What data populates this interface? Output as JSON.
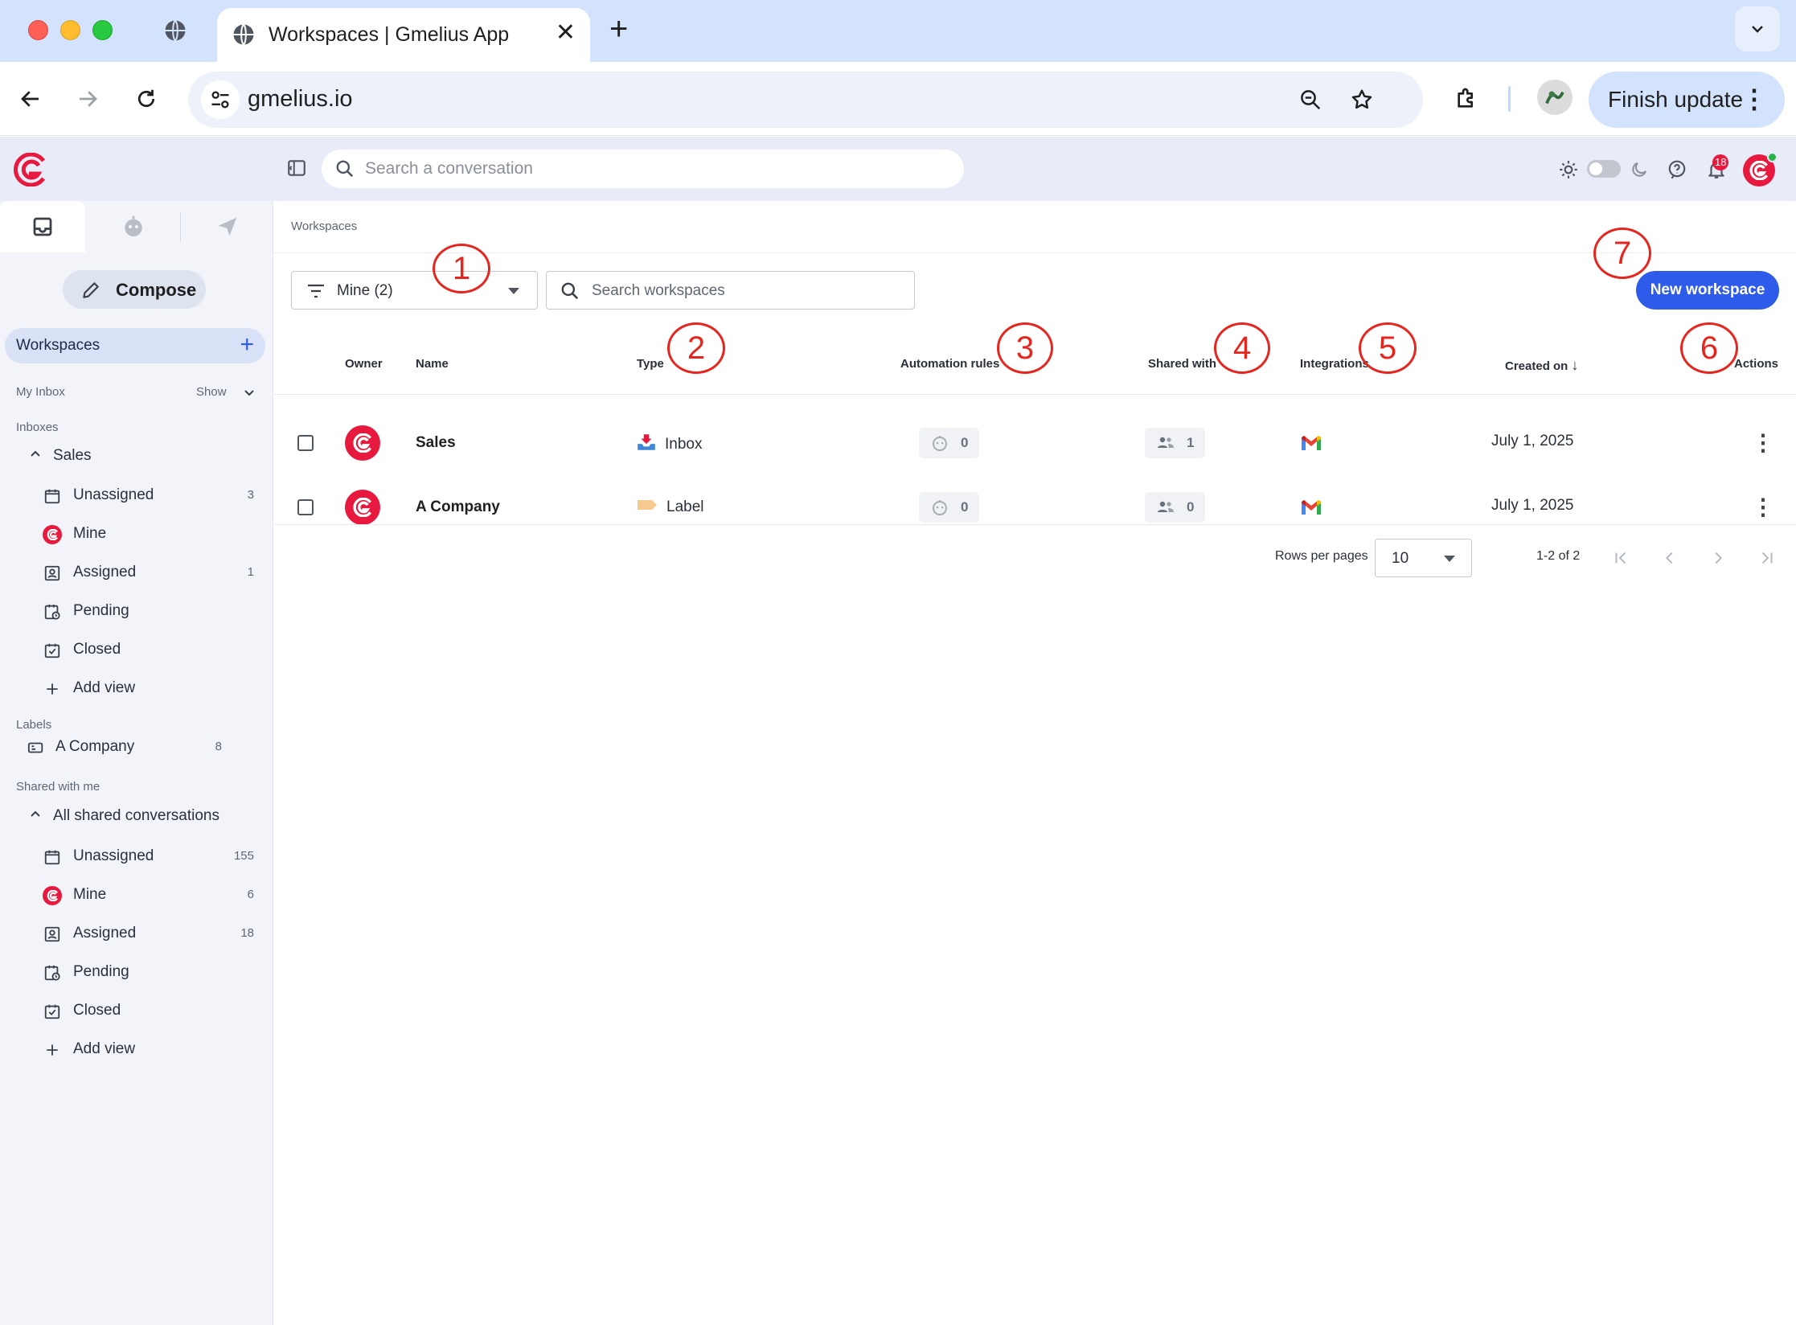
{
  "browser": {
    "tab_title": "Workspaces | Gmelius App",
    "tab_close": "✕",
    "new_tab": "+",
    "url": "gmelius.io",
    "finish_update": "Finish update",
    "menu_dots": "⋮"
  },
  "header": {
    "search_placeholder": "Search a conversation",
    "notification_count": "18"
  },
  "sidebar": {
    "compose_label": "Compose",
    "workspaces_label": "Workspaces",
    "workspaces_add": "+",
    "my_inbox_label": "My Inbox",
    "show_label": "Show",
    "inboxes_label": "Inboxes",
    "sales_group": "Sales",
    "sales_items": [
      {
        "label": "Unassigned",
        "count": "3",
        "icon": "calendar-icon"
      },
      {
        "label": "Mine",
        "count": "",
        "icon": "gmelius-logo-icon"
      },
      {
        "label": "Assigned",
        "count": "1",
        "icon": "assigned-icon"
      },
      {
        "label": "Pending",
        "count": "",
        "icon": "pending-icon"
      },
      {
        "label": "Closed",
        "count": "",
        "icon": "closed-icon"
      },
      {
        "label": "Add view",
        "count": "",
        "icon": "plus-icon"
      }
    ],
    "labels_label": "Labels",
    "label_items": [
      {
        "label": "A Company",
        "count": "8",
        "icon": "label-icon"
      }
    ],
    "shared_label": "Shared with me",
    "shared_group": "All shared conversations",
    "shared_items": [
      {
        "label": "Unassigned",
        "count": "155",
        "icon": "calendar-icon"
      },
      {
        "label": "Mine",
        "count": "6",
        "icon": "gmelius-logo-icon"
      },
      {
        "label": "Assigned",
        "count": "18",
        "icon": "assigned-icon"
      },
      {
        "label": "Pending",
        "count": "",
        "icon": "pending-icon"
      },
      {
        "label": "Closed",
        "count": "",
        "icon": "closed-icon"
      },
      {
        "label": "Add view",
        "count": "",
        "icon": "plus-icon"
      }
    ]
  },
  "main": {
    "breadcrumb": "Workspaces",
    "filter_value": "Mine (2)",
    "search_placeholder": "Search workspaces",
    "new_workspace": "New workspace",
    "columns": [
      "Owner",
      "Name",
      "Type",
      "Automation rules",
      "Shared with",
      "Integrations",
      "Created on",
      "Actions"
    ],
    "sort_arrow": "↓",
    "rows": [
      {
        "name": "Sales",
        "type": "Inbox",
        "type_icon": "inbox-tray-icon",
        "automation_rules": "0",
        "shared_with": "1",
        "integration": "gmail-icon",
        "created_on": "July 1, 2025"
      },
      {
        "name": "A Company",
        "type": "Label",
        "type_icon": "label-tag-icon",
        "automation_rules": "0",
        "shared_with": "0",
        "integration": "gmail-icon",
        "created_on": "July 1, 2025"
      }
    ],
    "rows_per_page_label": "Rows per pages",
    "rows_per_page_value": "10",
    "range_text": "1-2 of 2"
  },
  "annotations": [
    "1",
    "2",
    "3",
    "4",
    "5",
    "6",
    "7"
  ],
  "colors": {
    "brand_red": "#e8193e",
    "accent_blue": "#2f5bea",
    "annotation_red": "#e5261f",
    "chrome_blue": "#d3e3fd"
  }
}
